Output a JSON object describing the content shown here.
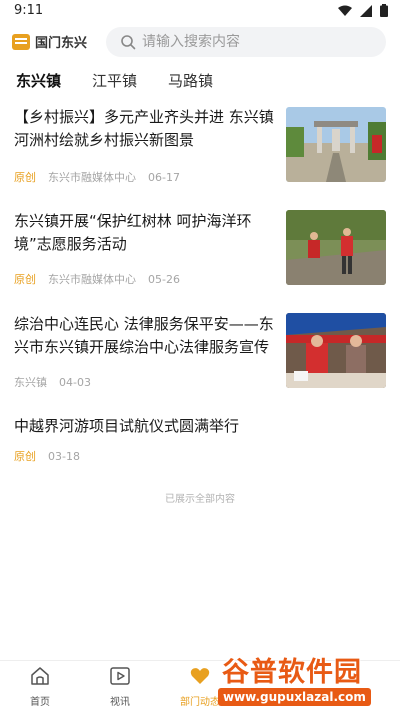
{
  "status_bar": {
    "time": "9:11"
  },
  "header": {
    "logo_text": "国门东兴",
    "search_placeholder": "请输入搜索内容"
  },
  "tabs": [
    {
      "label": "东兴镇",
      "active": true
    },
    {
      "label": "江平镇",
      "active": false
    },
    {
      "label": "马路镇",
      "active": false
    }
  ],
  "news": [
    {
      "title_lines": [
        "【乡村振兴】多元产业齐头并进  东兴镇",
        "河洲村绘就乡村振兴新图景"
      ],
      "tag": "原创",
      "source": "东兴市融媒体中心",
      "date": "06-17"
    },
    {
      "title_lines": [
        "东兴镇开展“保护红树林  呵护海洋环",
        "境”志愿服务活动"
      ],
      "tag": "原创",
      "source": "东兴市融媒体中心",
      "date": "05-26"
    },
    {
      "title_lines": [
        "综治中心连民心  法律服务保平安——东",
        "兴市东兴镇开展综治中心法律服务宣传"
      ],
      "tag": "",
      "source": "东兴镇",
      "date": "04-03"
    },
    {
      "title_lines": [
        "中越界河游项目试航仪式圆满举行"
      ],
      "tag": "原创",
      "source": "",
      "date": "03-18"
    }
  ],
  "end_note": "已展示全部内容",
  "bottom_nav": [
    {
      "label": "首页",
      "icon": "home-icon",
      "active": false
    },
    {
      "label": "视讯",
      "icon": "video-icon",
      "active": false
    },
    {
      "label": "部门动态",
      "icon": "heart-icon",
      "active": true
    }
  ],
  "watermark": {
    "text_cn": "谷普软件园",
    "url": "www.gupuxlazal.com"
  },
  "colors": {
    "accent": "#e8a020",
    "watermark": "#e85a14"
  }
}
